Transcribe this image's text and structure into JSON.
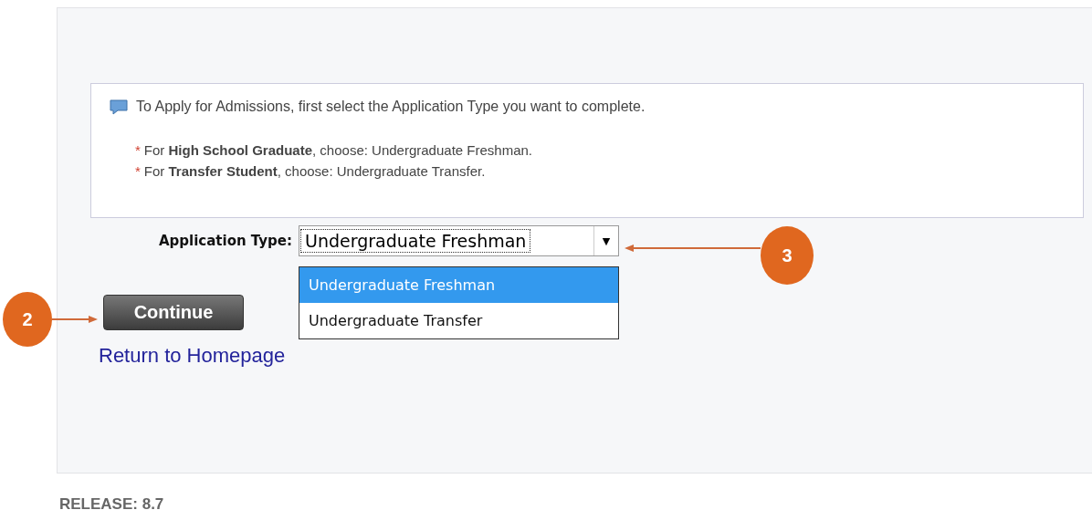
{
  "message": {
    "text": "To Apply for Admissions, first select the Application Type you want to complete."
  },
  "notes": [
    {
      "marker": "*",
      "text": "For **High School Graduate**, choose: Undergraduate Freshman."
    },
    {
      "marker": "*",
      "text": "For **Transfer Student**, choose: Undergraduate Transfer."
    }
  ],
  "application_type": {
    "label": "Application Type:",
    "value": "Undergraduate Freshman",
    "caret": "▼",
    "expanded": true,
    "options": [
      {
        "label": "Undergraduate Freshman",
        "selected": true
      },
      {
        "label": "Undergraduate Transfer",
        "selected": false
      }
    ]
  },
  "continue_button": "Continue",
  "home_link": "Return to Homepage",
  "callouts": [
    {
      "number": "2"
    },
    {
      "number": "3"
    }
  ],
  "release": "RELEASE: 8.7"
}
